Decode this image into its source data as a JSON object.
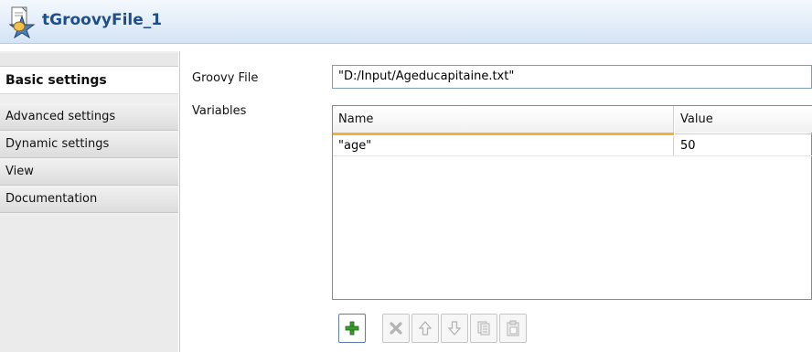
{
  "header": {
    "title": "tGroovyFile_1"
  },
  "sidebar": {
    "tabs": [
      {
        "label": "Basic settings"
      },
      {
        "label": "Advanced settings"
      },
      {
        "label": "Dynamic settings"
      },
      {
        "label": "View"
      },
      {
        "label": "Documentation"
      }
    ]
  },
  "form": {
    "groovy_file_label": "Groovy File",
    "groovy_file_value": "\"D:/Input/Ageducapitaine.txt\"",
    "variables_label": "Variables"
  },
  "variables_table": {
    "columns": [
      "Name",
      "Value"
    ],
    "rows": [
      {
        "name": "\"age\"",
        "value": "50"
      }
    ]
  },
  "toolbar": {
    "buttons": [
      {
        "icon": "add-icon",
        "enabled": true
      },
      {
        "icon": "delete-icon",
        "enabled": false
      },
      {
        "icon": "move-up-icon",
        "enabled": false
      },
      {
        "icon": "move-down-icon",
        "enabled": false
      },
      {
        "icon": "copy-icon",
        "enabled": false
      },
      {
        "icon": "paste-icon",
        "enabled": false
      }
    ]
  },
  "colors": {
    "header_title": "#1f4f8a",
    "column_accent": "#f3b13a",
    "add_button_icon": "#3a9a2a"
  }
}
